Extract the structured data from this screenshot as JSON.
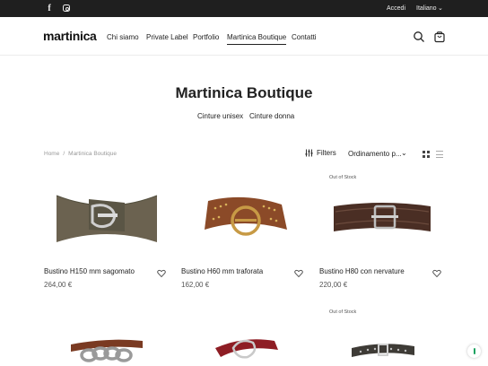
{
  "topbar": {
    "social": [
      "facebook-icon",
      "instagram-icon"
    ],
    "login": "Accedi",
    "language": "Italiano"
  },
  "header": {
    "logo": "martinica",
    "nav": [
      "Chi siamo",
      "Private Label",
      "Portfolio",
      "Martinica Boutique",
      "Contatti"
    ],
    "active_nav": "Martinica Boutique"
  },
  "category": {
    "title": "Martinica Boutique",
    "subcategories": [
      "Cinture unisex",
      "Cinture donna"
    ]
  },
  "breadcrumb": {
    "home": "Home",
    "sep": "/",
    "current": "Martinica Boutique"
  },
  "toolbar": {
    "filters": "Filters",
    "sort": "Ordinamento p..."
  },
  "products": [
    {
      "name": "Bustino H150 mm sagomato",
      "price": "264,00 €",
      "badge": ""
    },
    {
      "name": "Bustino H60 mm traforata",
      "price": "162,00 €",
      "badge": ""
    },
    {
      "name": "Bustino H80 con nervature",
      "price": "220,00 €",
      "badge": "Out of Stock"
    },
    {
      "name": "",
      "price": "",
      "badge": ""
    },
    {
      "name": "",
      "price": "",
      "badge": ""
    },
    {
      "name": "",
      "price": "",
      "badge": "Out of Stock"
    }
  ],
  "colors": {
    "topbar_bg": "#1f1f1f",
    "text": "#222222",
    "muted": "#999999"
  }
}
